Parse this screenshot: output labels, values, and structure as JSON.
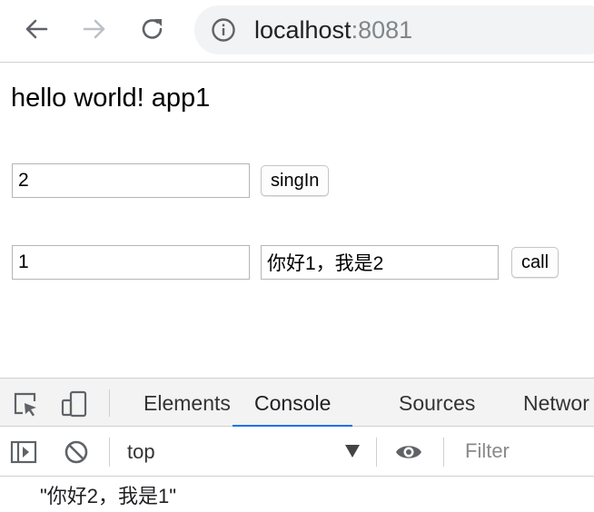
{
  "browser": {
    "back_icon": "arrow-left-icon",
    "forward_icon": "arrow-right-icon",
    "reload_icon": "reload-icon",
    "info_icon": "info-icon",
    "url_host": "localhost",
    "url_port": ":8081"
  },
  "page": {
    "heading": "hello world! app1",
    "signin_input_value": "2",
    "signin_button_label": "singIn",
    "call_target_value": "1",
    "call_message_value": "你好1，我是2",
    "call_button_label": "call"
  },
  "devtools": {
    "tabs": [
      {
        "label": "Elements",
        "active": false
      },
      {
        "label": "Console",
        "active": true
      },
      {
        "label": "Sources",
        "active": false
      },
      {
        "label": "Networ",
        "active": false
      }
    ],
    "context": "top",
    "filter_placeholder": "Filter",
    "console_output": [
      "\"你好2，我是1\""
    ],
    "accent_color": "#1a73e8"
  }
}
